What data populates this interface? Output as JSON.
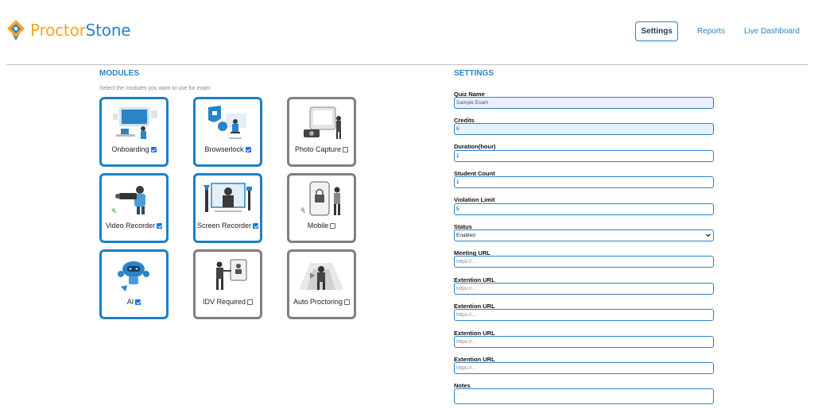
{
  "brand": {
    "part1": "Proctor",
    "part2": "Stone",
    "orange": "#f5a623",
    "blue": "#2a84c7"
  },
  "nav": {
    "settings": "Settings",
    "reports": "Reports",
    "live_dashboard": "Live Dashboard"
  },
  "modules": {
    "title": "MODULES",
    "subtitle": "Select the modules you want to use for exam",
    "cards": [
      {
        "label": "Onboarding",
        "checked": true,
        "icon": "onboarding-illustration"
      },
      {
        "label": "Browserlock",
        "checked": true,
        "icon": "browserlock-illustration"
      },
      {
        "label": "Photo Capture",
        "checked": false,
        "icon": "photo-capture-illustration"
      },
      {
        "label": "Video Recorder",
        "checked": true,
        "icon": "video-recorder-illustration"
      },
      {
        "label": "Screen Recorder",
        "checked": true,
        "icon": "screen-recorder-illustration"
      },
      {
        "label": "Mobile",
        "checked": false,
        "icon": "mobile-illustration"
      },
      {
        "label": "AI",
        "checked": true,
        "icon": "ai-robot-illustration"
      },
      {
        "label": "IDV Required",
        "checked": false,
        "icon": "idv-illustration"
      },
      {
        "label": "Auto Proctoring",
        "checked": false,
        "icon": "auto-proctoring-illustration"
      }
    ]
  },
  "settings": {
    "title": "SETTINGS",
    "quiz_name": {
      "label": "Quiz Name",
      "value": "Sample Exam"
    },
    "credits": {
      "label": "Credits",
      "value": "6"
    },
    "duration": {
      "label": "Duration(hour)",
      "value": "1"
    },
    "student_count": {
      "label": "Student Count",
      "value": "1"
    },
    "violation_limit": {
      "label": "Violation Limit",
      "value": "5"
    },
    "status": {
      "label": "Status",
      "value": "Enabled"
    },
    "meeting_url": {
      "label": "Meeting URL",
      "placeholder": "https://..."
    },
    "extention_url_1": {
      "label": "Extention URL",
      "placeholder": "https://..."
    },
    "extention_url_2": {
      "label": "Extention URL",
      "placeholder": "https://..."
    },
    "extention_url_3": {
      "label": "Extention URL",
      "placeholder": "https://..."
    },
    "extention_url_4": {
      "label": "Extention URL",
      "placeholder": "https://..."
    },
    "notes": {
      "label": "Notes",
      "placeholder": "· · ·"
    }
  }
}
